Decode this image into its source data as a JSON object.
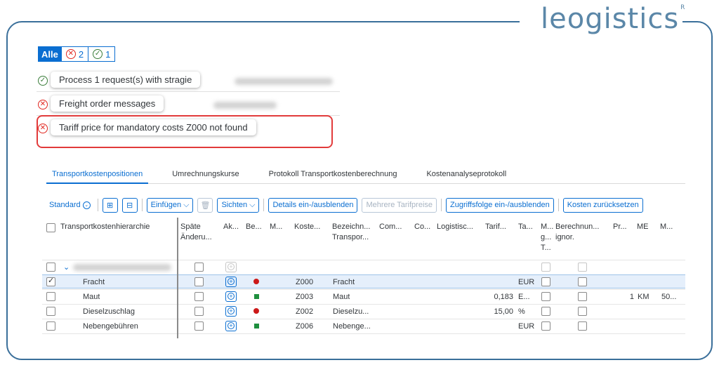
{
  "brand": {
    "logo_text": "leogistics",
    "logo_mark": "R"
  },
  "filter": {
    "all_label": "Alle",
    "error_count": "2",
    "success_count": "1"
  },
  "messages": [
    {
      "type": "success",
      "text": "Process 1 request(s) with stragie"
    },
    {
      "type": "error",
      "text": "Freight order messages"
    },
    {
      "type": "error",
      "text": "Tariff price for mandatory costs Z000 not found"
    }
  ],
  "tabs": [
    {
      "label": "Transportkostenpositionen",
      "active": true
    },
    {
      "label": "Umrechnungskurse",
      "active": false
    },
    {
      "label": "Protokoll Transportkostenberechnung",
      "active": false
    },
    {
      "label": "Kostenanalyseprotokoll",
      "active": false
    }
  ],
  "toolbar": {
    "variant_label": "Standard",
    "insert_label": "Einfügen",
    "views_label": "Sichten",
    "details_label": "Details ein-/ausblenden",
    "multiple_tariffs_label": "Mehrere Tarifpreise",
    "access_sequence_label": "Zugriffsfolge ein-/ausblenden",
    "reset_costs_label": "Kosten zurücksetzen"
  },
  "table": {
    "columns": [
      "Transportkostenhierarchie",
      "Späte Änderu...",
      "Ak...",
      "Be...",
      "M...",
      "Koste...",
      "Bezeichn... Transpor...",
      "Com...",
      "Co...",
      "Logistisc...",
      "Tarif...",
      "Ta...",
      "M... g... T...",
      "Berechnun... ignor.",
      "Pr...",
      "ME",
      "M..."
    ],
    "rows": [
      {
        "name": "",
        "code": "",
        "desc": "",
        "tariff": "",
        "currency": "",
        "qty": "",
        "unit": "",
        "extra": "",
        "selected": false,
        "status": "",
        "is_parent": true
      },
      {
        "name": "Fracht",
        "code": "Z000",
        "desc": "Fracht",
        "tariff": "",
        "currency": "EUR",
        "qty": "",
        "unit": "",
        "extra": "",
        "selected": true,
        "status": "red"
      },
      {
        "name": "Maut",
        "code": "Z003",
        "desc": "Maut",
        "tariff": "0,183",
        "currency": "E...",
        "qty": "1",
        "unit": "KM",
        "extra": "50...",
        "selected": false,
        "status": "green"
      },
      {
        "name": "Dieselzuschlag",
        "code": "Z002",
        "desc": "Dieselzu...",
        "tariff": "15,00",
        "currency": "%",
        "qty": "",
        "unit": "",
        "extra": "",
        "selected": false,
        "status": "red"
      },
      {
        "name": "Nebengebühren",
        "code": "Z006",
        "desc": "Nebenge...",
        "tariff": "",
        "currency": "EUR",
        "qty": "",
        "unit": "",
        "extra": "",
        "selected": false,
        "status": "green"
      }
    ]
  },
  "colors": {
    "accent": "#0a6ed1",
    "error": "#e0261f",
    "status_red": "#cc1919",
    "status_green": "#1e8f3e",
    "frame": "#3a6f9a"
  }
}
